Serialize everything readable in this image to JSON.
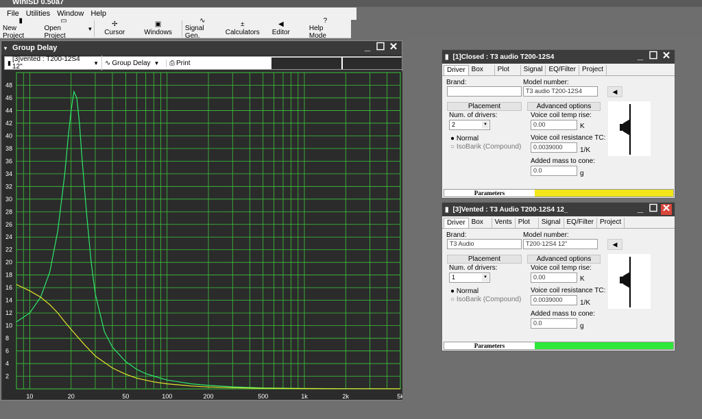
{
  "app": {
    "title": "WinISD 0.50a7"
  },
  "menu": {
    "items": [
      "File",
      "Utilities",
      "Window",
      "Help"
    ]
  },
  "toolbar": {
    "buttons": [
      {
        "label": "New Project",
        "icon": "▮"
      },
      {
        "label": "Open Project",
        "icon": "▭"
      },
      {
        "label": "Cursor",
        "icon": "✢"
      },
      {
        "label": "Windows",
        "icon": "▣"
      },
      {
        "label": "Signal Gen.",
        "icon": "∿"
      },
      {
        "label": "Calculators",
        "icon": "±"
      },
      {
        "label": "Editor",
        "icon": "◀"
      },
      {
        "label": "Help Mode",
        "icon": "?"
      }
    ]
  },
  "graph_window": {
    "title": "Group Delay",
    "project_select": "[3]vented : T200-12S4 12\"",
    "graph_select": "Group Delay",
    "print_label": "Print"
  },
  "chart_data": {
    "type": "line",
    "title": "",
    "xlabel": "",
    "ylabel": "",
    "x_scale": "log",
    "xlim": [
      8,
      5000
    ],
    "ylim": [
      0,
      50
    ],
    "x_ticks": [
      "10",
      "20",
      "50",
      "100",
      "200",
      "500",
      "1k",
      "2k",
      "5k"
    ],
    "y_ticks": [
      "2",
      "4",
      "6",
      "8",
      "10",
      "12",
      "14",
      "16",
      "18",
      "20",
      "22",
      "24",
      "26",
      "28",
      "30",
      "32",
      "34",
      "36",
      "38",
      "40",
      "42",
      "44",
      "46",
      "48"
    ],
    "grid": true,
    "colors": {
      "background": "#2b2b2b",
      "grid": "#3cc83c",
      "vented": "#2ee86a",
      "closed": "#e6e62a"
    },
    "series": [
      {
        "name": "",
        "color": "#2ee86a",
        "x": [
          8,
          10,
          12,
          14,
          16,
          18,
          19,
          20,
          21,
          22,
          23,
          24,
          26,
          28,
          30,
          35,
          40,
          50,
          60,
          70,
          80,
          100,
          150,
          200,
          300,
          500,
          1000,
          2000,
          5000
        ],
        "y": [
          10.6,
          12.0,
          14.5,
          18.5,
          25.0,
          34.0,
          39.5,
          44.0,
          47.0,
          46.0,
          42.0,
          36.5,
          27.5,
          20.0,
          15.0,
          9.0,
          6.6,
          4.3,
          3.1,
          2.4,
          2.0,
          1.4,
          0.8,
          0.55,
          0.32,
          0.15,
          0.06,
          0.03,
          0.01
        ]
      },
      {
        "name": "",
        "color": "#e6e62a",
        "x": [
          8,
          10,
          12,
          14,
          16,
          18,
          20,
          25,
          30,
          40,
          50,
          60,
          80,
          100,
          150,
          200,
          300,
          500,
          1000,
          2000,
          5000
        ],
        "y": [
          16.5,
          15.5,
          14.5,
          13.3,
          12.0,
          10.6,
          9.4,
          7.0,
          5.2,
          3.3,
          2.3,
          1.7,
          1.1,
          0.8,
          0.45,
          0.3,
          0.18,
          0.09,
          0.04,
          0.02,
          0.01
        ]
      }
    ]
  },
  "closed_window": {
    "title": "[1]Closed : T3 audio T200-12S4",
    "tabs": [
      "Driver",
      "Box",
      "Plot",
      "Signal",
      "EQ/Filter",
      "Project"
    ],
    "brand_label": "Brand:",
    "brand_value": "",
    "model_label": "Model number:",
    "model_value": "T3 audio T200-12S4",
    "placement_label": "Placement",
    "advanced_label": "Advanced options",
    "num_drivers_label": "Num. of drivers:",
    "num_drivers_value": "2",
    "radio_normal": "Normal",
    "radio_isobarik": "IsoBarik (Compound)",
    "vc_temp_label": "Voice coil temp rise:",
    "vc_temp_value": "0.00",
    "vc_temp_unit": "K",
    "vc_tc_label": "Voice coil resistance TC:",
    "vc_tc_value": "0.0039000",
    "vc_tc_unit": "1/K",
    "added_mass_label": "Added mass to cone:",
    "added_mass_value": "0.0",
    "added_mass_unit": "g",
    "params_label": "Parameters",
    "params_color": "#f2e61a",
    "params_fill": 1.0
  },
  "vented_window": {
    "title": "[3]Vented : T3 Audio T200-12S4 12_",
    "tabs": [
      "Driver",
      "Box",
      "Vents",
      "Plot",
      "Signal",
      "EQ/Filter",
      "Project"
    ],
    "brand_label": "Brand:",
    "brand_value": "T3 Audio",
    "model_label": "Model number:",
    "model_value": "T200-12S4 12\"",
    "placement_label": "Placement",
    "advanced_label": "Advanced options",
    "num_drivers_label": "Num. of drivers:",
    "num_drivers_value": "1",
    "radio_normal": "Normal",
    "radio_isobarik": "IsoBarik (Compound)",
    "vc_temp_label": "Voice coil temp rise:",
    "vc_temp_value": "0.00",
    "vc_temp_unit": "K",
    "vc_tc_label": "Voice coil resistance TC:",
    "vc_tc_value": "0.0039000",
    "vc_tc_unit": "1/K",
    "added_mass_label": "Added mass to cone:",
    "added_mass_value": "0.0",
    "added_mass_unit": "g",
    "params_label": "Parameters",
    "params_color": "#2ee83a",
    "params_fill": 1.0
  }
}
